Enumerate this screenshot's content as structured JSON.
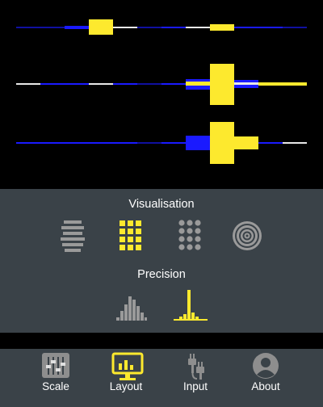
{
  "colors": {
    "accent": "#fde92e",
    "blue": "#1a1aff",
    "white": "#e8e8e8",
    "inactive": "#9a9a9a",
    "panel": "#3a4248",
    "background": "#000000"
  },
  "visualisation": {
    "title": "Visualisation",
    "options": [
      {
        "icon": "stacked-bars-icon",
        "selected": false
      },
      {
        "icon": "grid-squares-icon",
        "selected": true
      },
      {
        "icon": "dot-grid-icon",
        "selected": false
      },
      {
        "icon": "concentric-circles-icon",
        "selected": false
      }
    ]
  },
  "precision": {
    "title": "Precision",
    "options": [
      {
        "icon": "wide-histogram-icon",
        "selected": false
      },
      {
        "icon": "narrow-histogram-icon",
        "selected": true
      }
    ]
  },
  "tabs": [
    {
      "label": "Scale",
      "icon": "sliders-icon",
      "selected": false
    },
    {
      "label": "Layout",
      "icon": "monitor-chart-icon",
      "selected": true
    },
    {
      "label": "Input",
      "icon": "audio-plugs-icon",
      "selected": false
    },
    {
      "label": "About",
      "icon": "user-circle-icon",
      "selected": false
    }
  ]
}
